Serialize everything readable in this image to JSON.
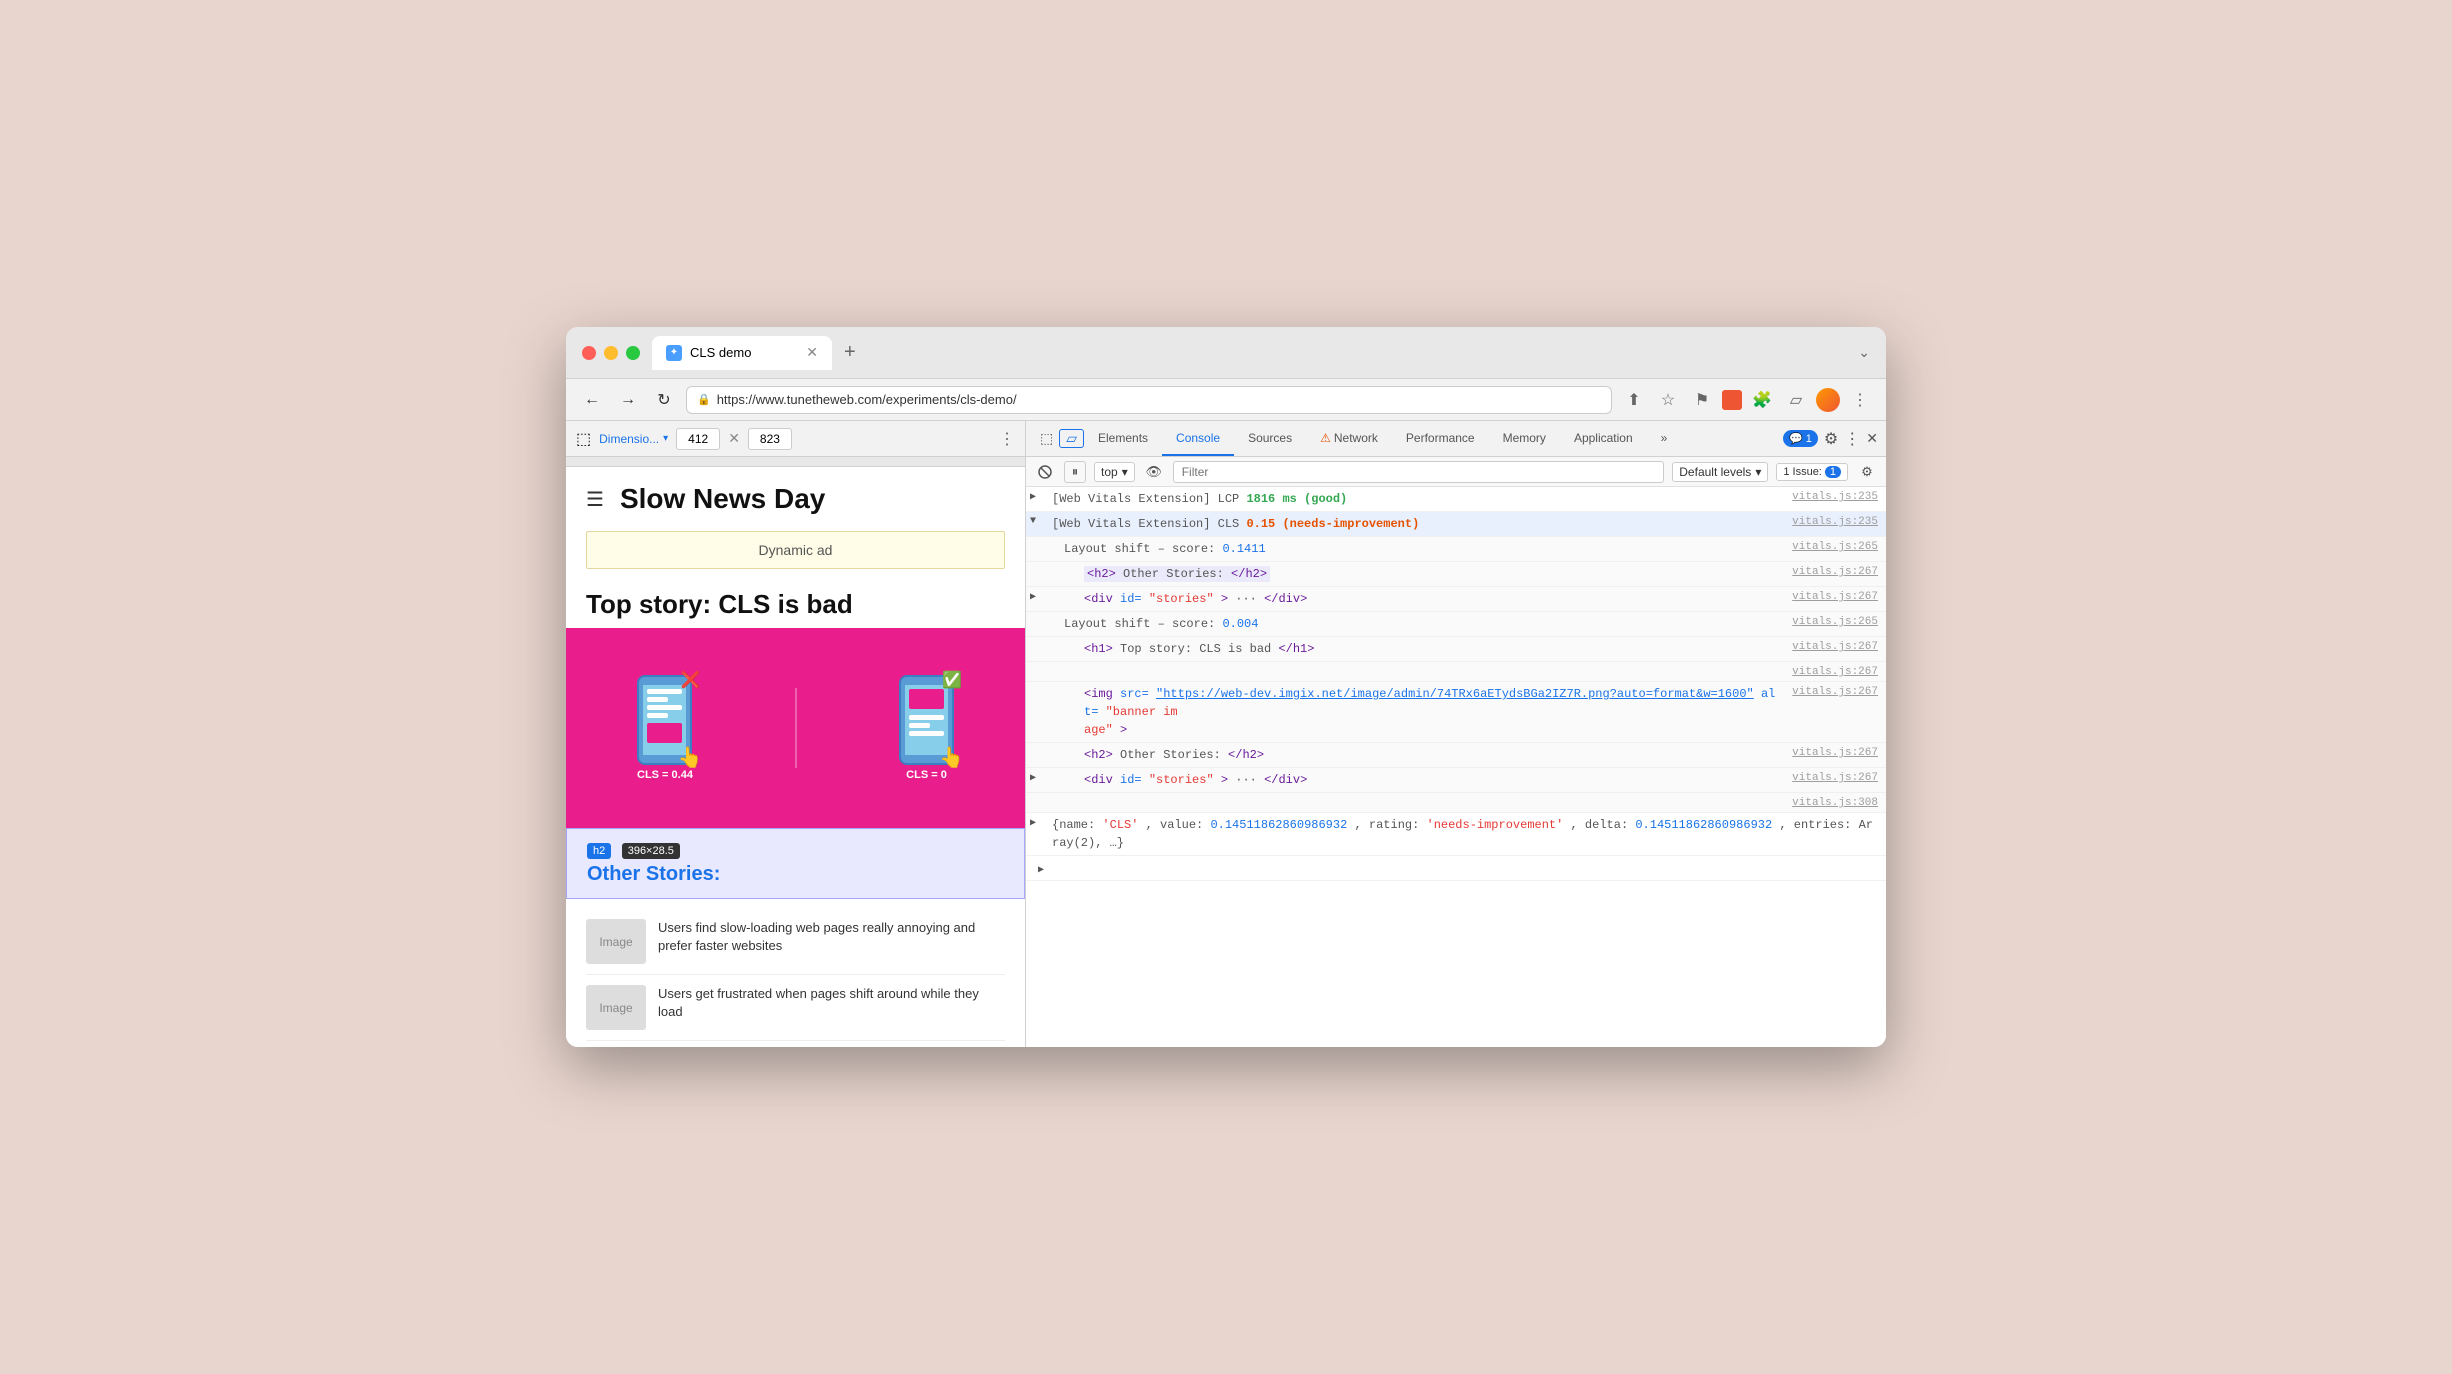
{
  "window": {
    "title": "CLS demo",
    "url": "https://www.tunetheweb.com/experiments/cls-demo/"
  },
  "tabs": [
    {
      "label": "CLS demo",
      "active": true
    }
  ],
  "toolbar": {
    "back": "←",
    "forward": "→",
    "refresh": "↻",
    "more": "⋮",
    "chevron": "⌄"
  },
  "viewport": {
    "label": "Dimensio...",
    "width": "412",
    "height": "823"
  },
  "devtools": {
    "panels": [
      "Elements",
      "Console",
      "Sources",
      "Network",
      "Performance",
      "Memory",
      "Application"
    ],
    "active_panel": "Console",
    "badge_count": "1",
    "issues_label": "1 Issue:",
    "issues_count": "1",
    "settings_icon": "⚙",
    "more_icon": "⋮",
    "close_icon": "✕"
  },
  "console_toolbar": {
    "clear_icon": "🚫",
    "top_label": "top",
    "eye_icon": "👁",
    "filter_placeholder": "Filter",
    "default_levels": "Default levels",
    "issues_label": "1 Issue:",
    "issues_badge": "1",
    "gear_icon": "⚙"
  },
  "site": {
    "title": "Slow News Day",
    "ad_text": "Dynamic ad",
    "article_title": "Top story: CLS is bad",
    "other_stories": "Other Stories:",
    "stories": [
      {
        "thumb": "Image",
        "text": "Users find slow-loading web pages really annoying and prefer faster websites"
      },
      {
        "thumb": "Image",
        "text": "Users get frustrated when pages shift around while they load"
      }
    ],
    "cls_bad": "CLS = 0.44",
    "cls_good": "CLS = 0"
  },
  "console_entries": [
    {
      "type": "expandable",
      "expanded": false,
      "prefix": "[Web Vitals Extension] LCP",
      "value": "1816 ms (good)",
      "value_class": "lcp-good",
      "link": "vitals.js:235"
    },
    {
      "type": "expandable",
      "expanded": true,
      "prefix": "[Web Vitals Extension] CLS",
      "value": "0.15 (needs-improvement)",
      "value_class": "cls-needs",
      "link": "vitals.js:235",
      "highlighted": true
    },
    {
      "type": "sub",
      "indent": 1,
      "text": "Layout shift – score:  0.1411",
      "score_val": "0.1411",
      "link": "vitals.js:265"
    },
    {
      "type": "sub",
      "indent": 2,
      "html": "<h2>Other Stories:</h2>",
      "link": "vitals.js:267"
    },
    {
      "type": "sub_expand",
      "indent": 2,
      "html": "<div id=\"stories\"> ··· </div>",
      "link": "vitals.js:267"
    },
    {
      "type": "sub",
      "indent": 1,
      "text": "Layout shift – score:  0.004",
      "score_val": "0.004",
      "link": "vitals.js:265"
    },
    {
      "type": "sub",
      "indent": 2,
      "html": "<h1>Top story: CLS is bad</h1>",
      "link": "vitals.js:267"
    },
    {
      "type": "blank",
      "link": "vitals.js:267"
    },
    {
      "type": "img_tag",
      "indent": 2,
      "link": "vitals.js:267",
      "src_url": "https://web-dev.imgix.net/image/admin/74TRx6aETydsBGa2IZ7R.png?auto=format&w=1600",
      "alt": "banner image"
    },
    {
      "type": "sub",
      "indent": 2,
      "html": "<h2>Other Stories:</h2>",
      "link": "vitals.js:267"
    },
    {
      "type": "sub_expand",
      "indent": 2,
      "html": "<div id=\"stories\"> ··· </div>",
      "link": "vitals.js:267"
    },
    {
      "type": "blank",
      "link": "vitals.js:308"
    },
    {
      "type": "object",
      "link": "",
      "text": "{name: 'CLS', value: 0.14511862860986932, rating: 'needs-improvement', delta: 0.14511862860986932, entries: Array(2), …}"
    }
  ]
}
